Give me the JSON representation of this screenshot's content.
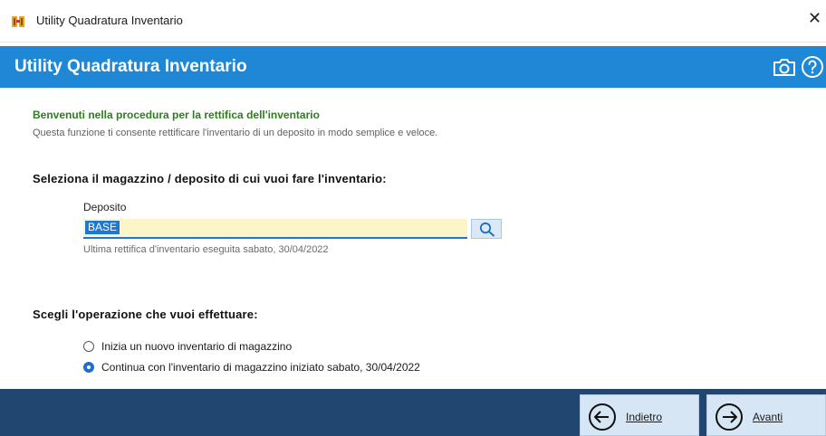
{
  "window": {
    "title": "Utility Quadratura Inventario",
    "close_glyph": "✕",
    "app_icon": "app-logo-icon"
  },
  "header": {
    "title": "Utility Quadratura Inventario",
    "icons": [
      "camera-icon",
      "help-icon"
    ],
    "color": "#1e88d6"
  },
  "welcome": {
    "title": "Benvenuti nella procedura per la rettifica dell'inventario",
    "description": "Questa funzione ti consente rettificare l'inventario di un deposito in modo semplice e veloce."
  },
  "warehouse_section": {
    "title": "Seleziona il magazzino / deposito di cui vuoi fare l'inventario:",
    "field_label": "Deposito",
    "value": "BASE",
    "last_adjustment": "Ultima rettifica d'inventario eseguita sabato, 30/04/2022"
  },
  "operation_section": {
    "title": "Scegli l'operazione che vuoi effettuare:",
    "options": [
      {
        "label": "Inizia un nuovo inventario di magazzino",
        "selected": false
      },
      {
        "label": "Continua con l'inventario di magazzino iniziato sabato, 30/04/2022",
        "selected": true
      }
    ]
  },
  "footer": {
    "back_label": "Indietro",
    "next_label": "Avanti",
    "color": "#21466f"
  }
}
